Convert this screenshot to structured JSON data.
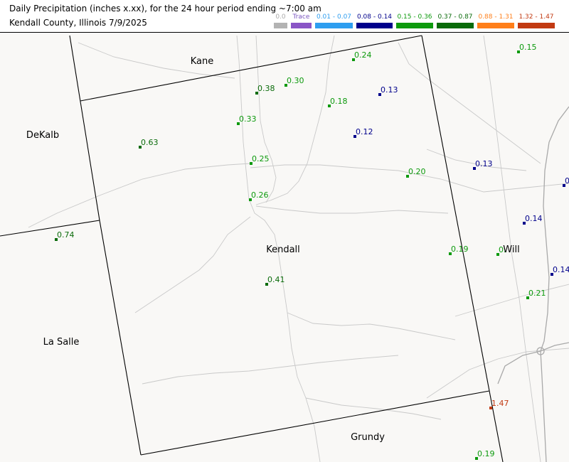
{
  "header": {
    "title": "Daily Precipitation (inches  x.xx),  for the 24 hour period ending ~7:00 am",
    "subtitle": "Kendall County, Illinois  7/9/2025"
  },
  "legend": [
    {
      "label": "0.0",
      "color": "#b3b3b3",
      "text_color": "#aaaaaa"
    },
    {
      "label": "Trace",
      "color": "#8a55c6",
      "text_color": "#7a55c0"
    },
    {
      "label": "0.01 - 0.07",
      "color": "#2e9ef0",
      "text_color": "#2e9ef0"
    },
    {
      "label": "0.08 - 0.14",
      "color": "#00008b",
      "text_color": "#00008b"
    },
    {
      "label": "0.15 - 0.36",
      "color": "#0d9a0d",
      "text_color": "#0d9a0d"
    },
    {
      "label": "0.37 - 0.87",
      "color": "#0a6b0a",
      "text_color": "#0a6b0a"
    },
    {
      "label": "0.88 - 1.31",
      "color": "#ff7f1a",
      "text_color": "#ff7f1a"
    },
    {
      "label": "1.32 - 1.47",
      "color": "#c23a12",
      "text_color": "#c23a12"
    }
  ],
  "counties": [
    {
      "name": "Kane"
    },
    {
      "name": "DeKalb"
    },
    {
      "name": "Kendall"
    },
    {
      "name": "La Salle"
    },
    {
      "name": "Will"
    },
    {
      "name": "Grundy"
    }
  ],
  "stations": [
    {
      "value": "0.24",
      "color": "#0d9a0d"
    },
    {
      "value": "0.15",
      "color": "#0d9a0d"
    },
    {
      "value": "0.38",
      "color": "#0a6b0a"
    },
    {
      "value": "0.30",
      "color": "#0d9a0d"
    },
    {
      "value": "0.13",
      "color": "#00008b"
    },
    {
      "value": "0.18",
      "color": "#0d9a0d"
    },
    {
      "value": "0.33",
      "color": "#0d9a0d"
    },
    {
      "value": "0.12",
      "color": "#00008b"
    },
    {
      "value": "0.63",
      "color": "#0a6b0a"
    },
    {
      "value": "0.25",
      "color": "#0d9a0d"
    },
    {
      "value": "0.13",
      "color": "#00008b"
    },
    {
      "value": "0.20",
      "color": "#0d9a0d"
    },
    {
      "value": "0",
      "color": "#00008b"
    },
    {
      "value": "0.26",
      "color": "#0d9a0d"
    },
    {
      "value": "0.14",
      "color": "#00008b"
    },
    {
      "value": "0.74",
      "color": "#0a6b0a"
    },
    {
      "value": "0.19",
      "color": "#0d9a0d"
    },
    {
      "value": "0.",
      "color": "#0d9a0d"
    },
    {
      "value": "0.14",
      "color": "#00008b"
    },
    {
      "value": "0.41",
      "color": "#0a6b0a"
    },
    {
      "value": "0.21",
      "color": "#0d9a0d"
    },
    {
      "value": "1.47",
      "color": "#c23a12"
    },
    {
      "value": "0.19",
      "color": "#0d9a0d"
    }
  ]
}
